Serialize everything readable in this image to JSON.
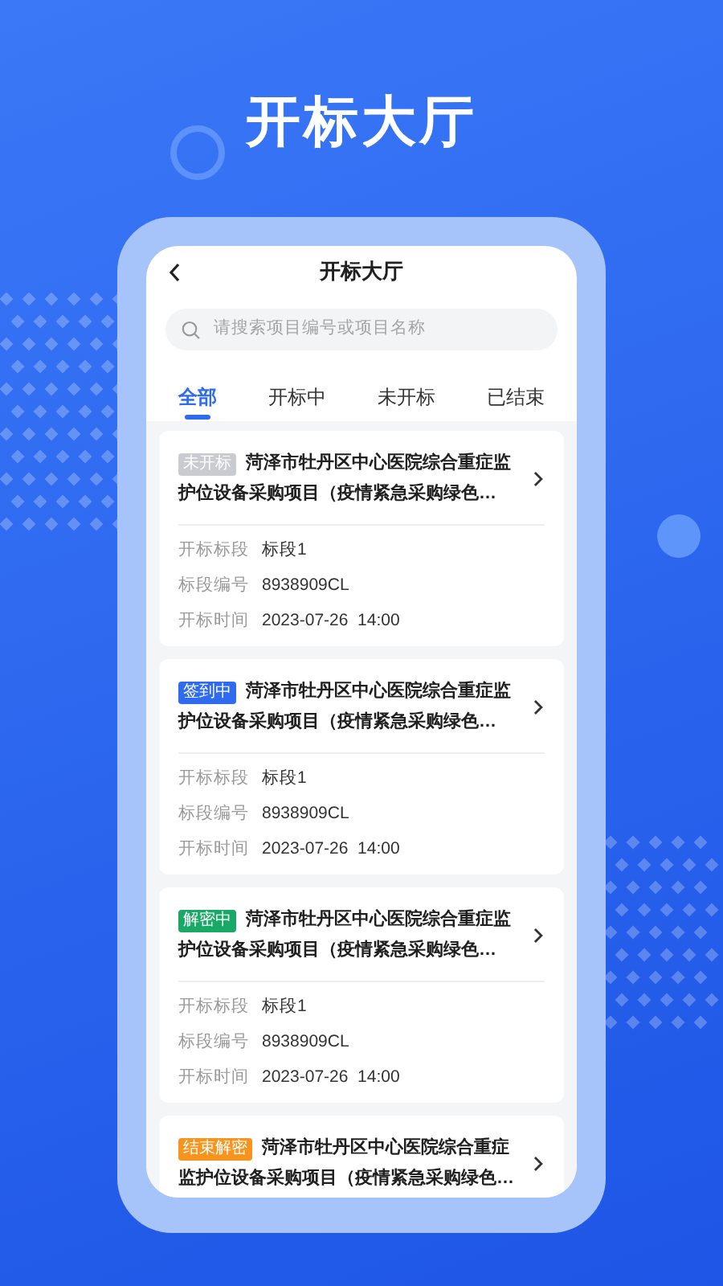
{
  "banner_title": "开标大厅",
  "screen": {
    "title": "开标大厅",
    "search": {
      "placeholder": "请搜索项目编号或项目名称"
    },
    "tabs": [
      {
        "label": "全部",
        "selected": true
      },
      {
        "label": "开标中",
        "selected": false
      },
      {
        "label": "未开标",
        "selected": false
      },
      {
        "label": "已结束",
        "selected": false
      }
    ],
    "cards": [
      {
        "tag": "未开标",
        "color": "#c9cbd0",
        "title_lines": [
          "菏泽市牡丹区中心医院综合重症监",
          "护位设备采购项目（疫情紧急采购绿色…"
        ],
        "fields": [
          {
            "label": "开标标段",
            "value": "标段1"
          },
          {
            "label": "标段编号",
            "value": "8938909CL"
          },
          {
            "label": "开标时间",
            "value": "2023-07-26  14:00"
          }
        ]
      },
      {
        "tag": "签到中",
        "color": "#2e6bef",
        "title_lines": [
          "菏泽市牡丹区中心医院综合重症监",
          "护位设备采购项目（疫情紧急采购绿色…"
        ],
        "fields": [
          {
            "label": "开标标段",
            "value": "标段1"
          },
          {
            "label": "标段编号",
            "value": "8938909CL"
          },
          {
            "label": "开标时间",
            "value": "2023-07-26  14:00"
          }
        ]
      },
      {
        "tag": "解密中",
        "color": "#19a865",
        "title_lines": [
          "菏泽市牡丹区中心医院综合重症监",
          "护位设备采购项目（疫情紧急采购绿色…"
        ],
        "fields": [
          {
            "label": "开标标段",
            "value": "标段1"
          },
          {
            "label": "标段编号",
            "value": "8938909CL"
          },
          {
            "label": "开标时间",
            "value": "2023-07-26  14:00"
          }
        ]
      },
      {
        "tag": "结束解密",
        "color": "#f7941d",
        "title_lines": [
          "菏泽市牡丹区中心医院综合重症",
          "监护位设备采购项目（疫情紧急采购绿色…"
        ]
      }
    ]
  }
}
